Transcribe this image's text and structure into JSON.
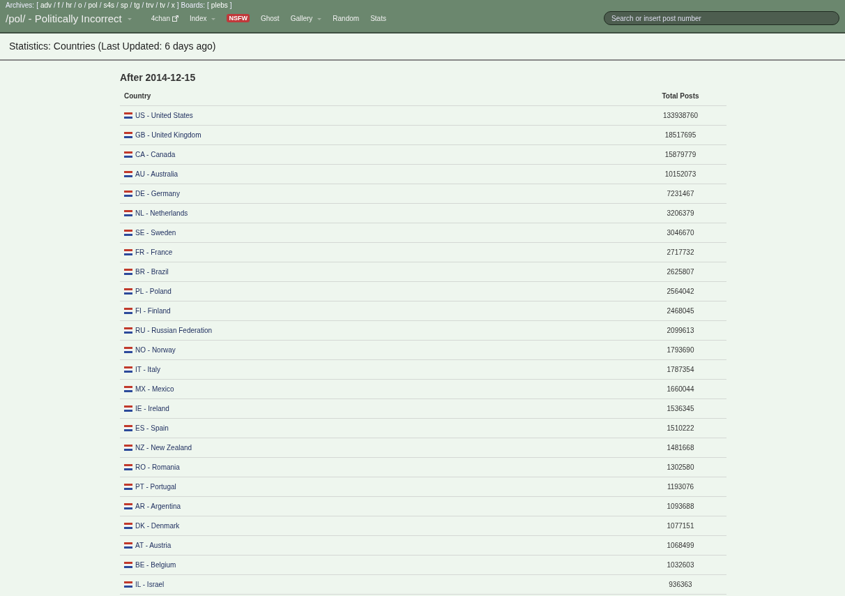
{
  "top_bar": {
    "groups": [
      {
        "label": "Archives:",
        "open": "[",
        "separator": "/",
        "close": "]",
        "links": [
          "adv",
          "f",
          "hr",
          "o",
          "pol",
          "s4s",
          "sp",
          "tg",
          "trv",
          "tv",
          "x"
        ]
      },
      {
        "label": "Boards:",
        "open": "[",
        "close": "]",
        "links": [
          "plebs"
        ]
      }
    ]
  },
  "nav": {
    "board_title": "/pol/ - Politically Incorrect",
    "items": [
      {
        "kind": "external",
        "label": "4chan"
      },
      {
        "kind": "dropdown",
        "label": "Index"
      },
      {
        "kind": "badge",
        "label": "NSFW"
      },
      {
        "kind": "link",
        "label": "Ghost"
      },
      {
        "kind": "dropdown",
        "label": "Gallery"
      },
      {
        "kind": "link",
        "label": "Random"
      },
      {
        "kind": "link",
        "label": "Stats"
      }
    ],
    "search": {
      "placeholder": "Search or insert post number"
    }
  },
  "page_title": "Statistics: Countries (Last Updated: 6 days ago)",
  "section_title": "After 2014-12-15",
  "table": {
    "columns": [
      "Country",
      "Total Posts"
    ],
    "rows": [
      {
        "country": "US - United States",
        "total": "133938760"
      },
      {
        "country": "GB - United Kingdom",
        "total": "18517695"
      },
      {
        "country": "CA - Canada",
        "total": "15879779"
      },
      {
        "country": "AU - Australia",
        "total": "10152073"
      },
      {
        "country": "DE - Germany",
        "total": "7231467"
      },
      {
        "country": "NL - Netherlands",
        "total": "3206379"
      },
      {
        "country": "SE - Sweden",
        "total": "3046670"
      },
      {
        "country": "FR - France",
        "total": "2717732"
      },
      {
        "country": "BR - Brazil",
        "total": "2625807"
      },
      {
        "country": "PL - Poland",
        "total": "2564042"
      },
      {
        "country": "FI - Finland",
        "total": "2468045"
      },
      {
        "country": "RU - Russian Federation",
        "total": "2099613"
      },
      {
        "country": "NO - Norway",
        "total": "1793690"
      },
      {
        "country": "IT - Italy",
        "total": "1787354"
      },
      {
        "country": "MX - Mexico",
        "total": "1660044"
      },
      {
        "country": "IE - Ireland",
        "total": "1536345"
      },
      {
        "country": "ES - Spain",
        "total": "1510222"
      },
      {
        "country": "NZ - New Zealand",
        "total": "1481668"
      },
      {
        "country": "RO - Romania",
        "total": "1302580"
      },
      {
        "country": "PT - Portugal",
        "total": "1193076"
      },
      {
        "country": "AR - Argentina",
        "total": "1093688"
      },
      {
        "country": "DK - Denmark",
        "total": "1077151"
      },
      {
        "country": "AT - Austria",
        "total": "1068499"
      },
      {
        "country": "BE - Belgium",
        "total": "1032603"
      },
      {
        "country": "IL - Israel",
        "total": "936363"
      }
    ]
  }
}
